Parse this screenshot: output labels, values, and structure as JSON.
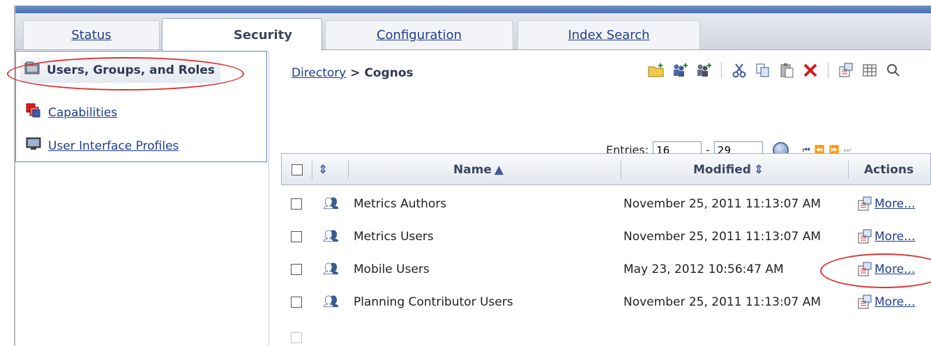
{
  "tabs": [
    {
      "label": "Status"
    },
    {
      "label": "Security"
    },
    {
      "label": "Configuration"
    },
    {
      "label": "Index Search"
    }
  ],
  "leftnav": {
    "items": [
      {
        "label": "Users, Groups, and Roles",
        "icon": "users-folder-icon"
      },
      {
        "label": "Capabilities",
        "icon": "capabilities-icon"
      },
      {
        "label": "User Interface Profiles",
        "icon": "ui-profile-icon"
      }
    ]
  },
  "breadcrumb": {
    "root": "Directory",
    "separator": ">",
    "current": "Cognos"
  },
  "toolbar": {
    "icons": [
      "new-folder-icon",
      "new-group-icon",
      "new-role-icon",
      "cut-icon",
      "copy-icon",
      "paste-icon",
      "delete-icon",
      "properties-icon",
      "view-icon",
      "search-icon"
    ]
  },
  "entries": {
    "label": "Entries:",
    "from": "16",
    "dash": "-",
    "to": "29"
  },
  "table": {
    "columns": {
      "name": "Name",
      "modified": "Modified",
      "actions": "Actions"
    },
    "rows": [
      {
        "name": "Metrics Authors",
        "modified": "November 25, 2011 11:13:07 AM",
        "action": "More..."
      },
      {
        "name": "Metrics Users",
        "modified": "November 25, 2011 11:13:07 AM",
        "action": "More..."
      },
      {
        "name": "Mobile Users",
        "modified": "May 23, 2012 10:56:47 AM",
        "action": "More..."
      },
      {
        "name": "Planning Contributor Users",
        "modified": "November 25, 2011 11:13:07 AM",
        "action": "More..."
      }
    ]
  },
  "colors": {
    "link": "#1f3d8f",
    "highlight_ellipse": "#dd3333",
    "topbar": "#4a6fae"
  }
}
